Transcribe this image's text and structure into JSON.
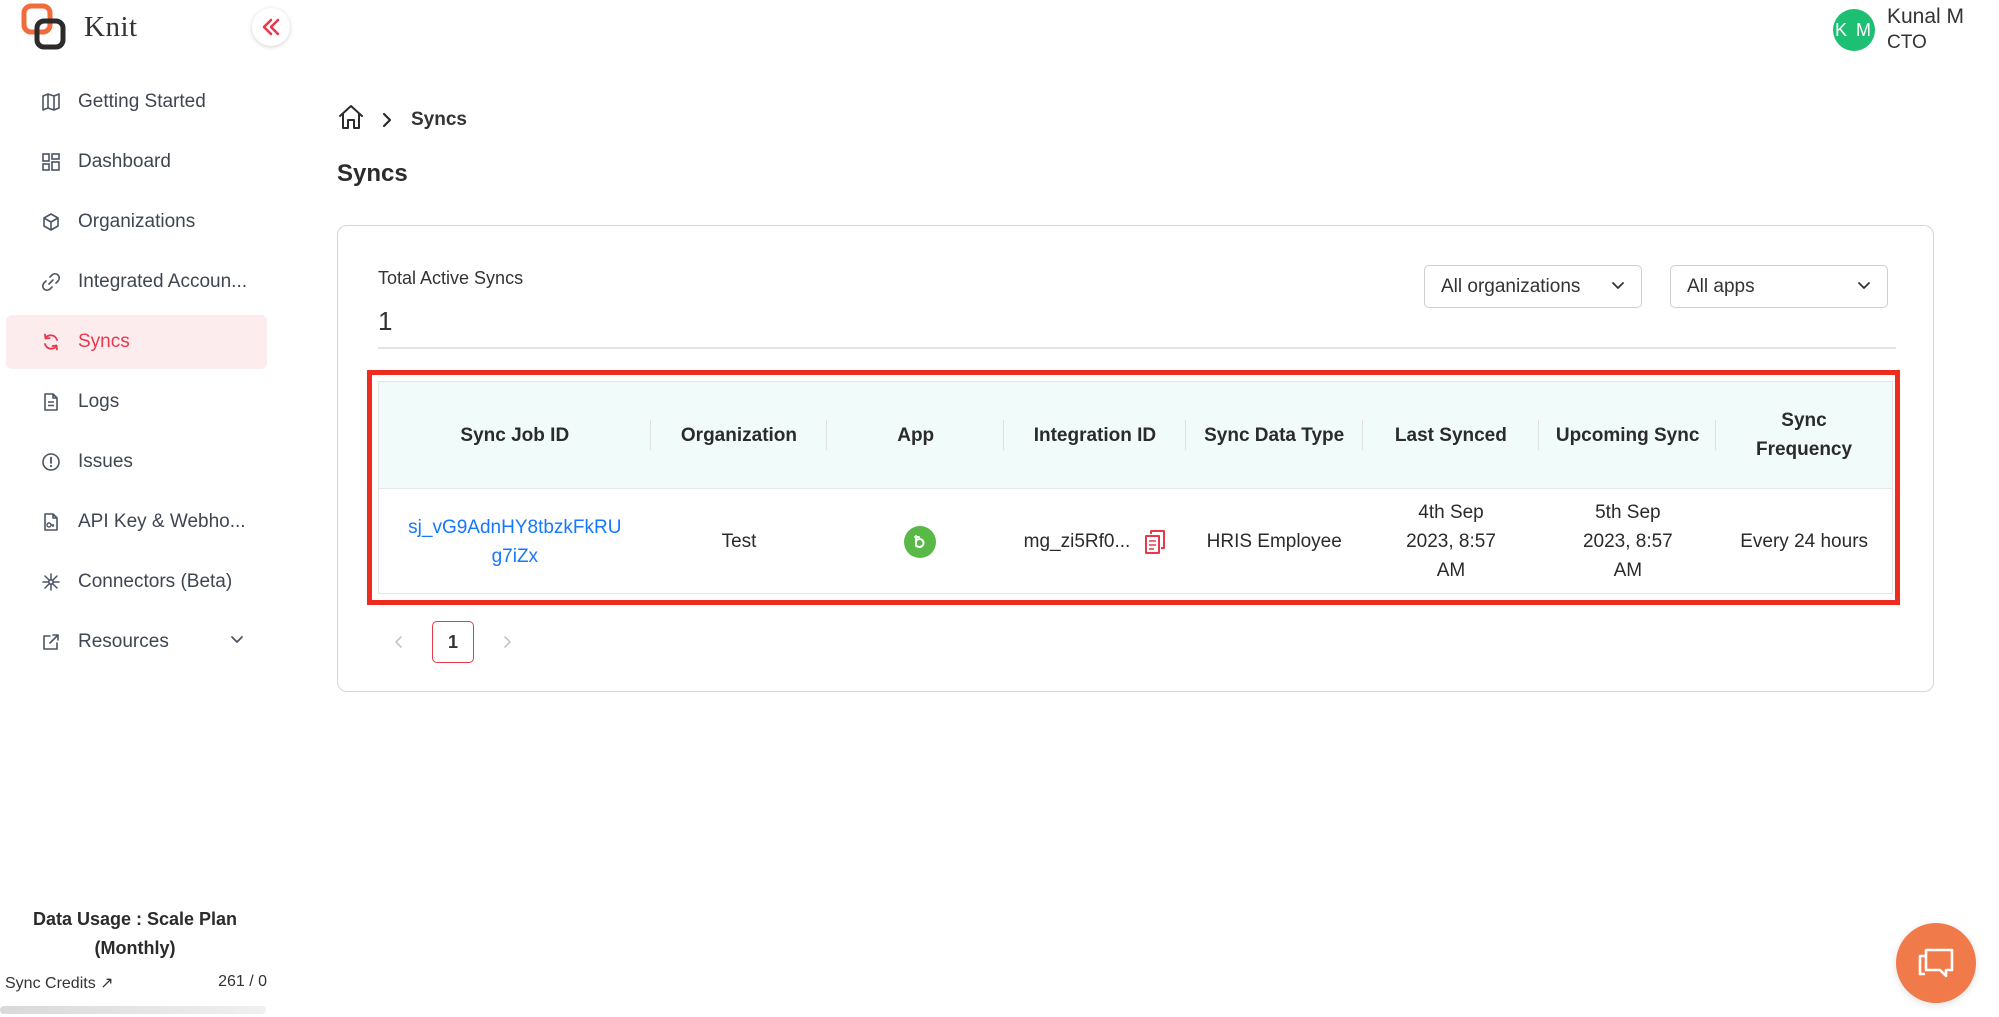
{
  "app": {
    "name": "Knit",
    "accent": "#e8394b"
  },
  "user": {
    "initials": "K M",
    "name": "Kunal M",
    "role": "CTO"
  },
  "sidebar": {
    "items": [
      {
        "label": "Getting Started",
        "icon": "map-icon"
      },
      {
        "label": "Dashboard",
        "icon": "grid-icon"
      },
      {
        "label": "Organizations",
        "icon": "cube-icon"
      },
      {
        "label": "Integrated Accoun...",
        "icon": "link-icon"
      },
      {
        "label": "Syncs",
        "icon": "sync-icon",
        "active": true
      },
      {
        "label": "Logs",
        "icon": "document-icon"
      },
      {
        "label": "Issues",
        "icon": "alert-icon"
      },
      {
        "label": "API Key & Webho...",
        "icon": "key-file-icon"
      },
      {
        "label": "Connectors (Beta)",
        "icon": "connectors-icon"
      },
      {
        "label": "Resources",
        "icon": "external-link-icon"
      }
    ],
    "usage_title": "Data Usage : Scale Plan (Monthly)",
    "credits_label": "Sync Credits ↗",
    "credits_value": "261 / 0"
  },
  "breadcrumb": {
    "current": "Syncs"
  },
  "page": {
    "title": "Syncs"
  },
  "summary": {
    "label": "Total Active Syncs",
    "value": "1"
  },
  "filters": {
    "organization": "All organizations",
    "apps": "All apps"
  },
  "table": {
    "headers": [
      "Sync Job ID",
      "Organization",
      "App",
      "Integration ID",
      "Sync Data Type",
      "Last Synced",
      "Upcoming Sync",
      "Sync Frequency"
    ],
    "rows": [
      {
        "sync_job_id": "sj_vG9AdnHY8tbzkFkRUg7iZx",
        "organization": "Test",
        "app_icon": "bamboohr-logo-icon",
        "integration_id": "mg_zi5Rf0...",
        "sync_data_type": "HRIS Employee",
        "last_synced": "4th Sep 2023, 8:57 AM",
        "upcoming_sync": "5th Sep 2023, 8:57 AM",
        "sync_frequency": "Every 24 hours"
      }
    ]
  },
  "pagination": {
    "current_page": "1"
  }
}
